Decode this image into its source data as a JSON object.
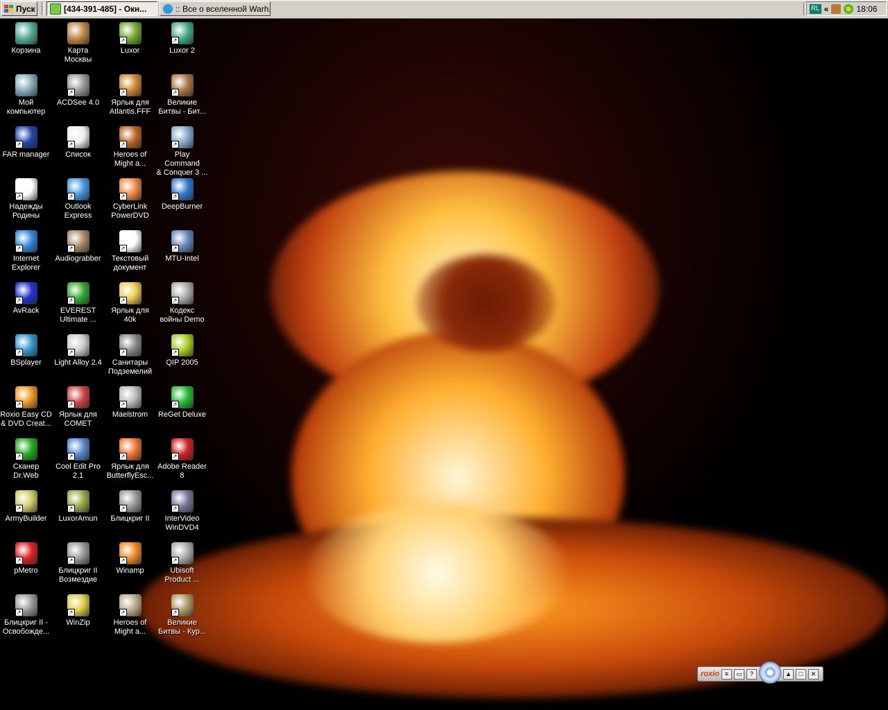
{
  "taskbar": {
    "start_label": "Пуск",
    "tasks": [
      {
        "label": "[434-391-485] - Окн...",
        "active": true
      },
      {
        "label": ":: Все о вселенной Warh...",
        "active": false
      }
    ],
    "tray": {
      "lang": "RL",
      "chevron": "«",
      "clock": "18:06"
    }
  },
  "roxio": {
    "logo": "roxio"
  },
  "icons": [
    {
      "label": "Корзина",
      "icon": "recycle-bin-icon",
      "color": "#5a9"
    },
    {
      "label": "Карта\nМосквы",
      "icon": "map-icon",
      "color": "#b84"
    },
    {
      "label": "Luxor",
      "icon": "scarab-icon",
      "color": "#7a3"
    },
    {
      "label": "Luxor 2",
      "icon": "scarab-icon",
      "color": "#4a8"
    },
    {
      "label": "Мой\nкомпьютер",
      "icon": "computer-icon",
      "color": "#8ab"
    },
    {
      "label": "ACDSee 4.0",
      "icon": "eye-icon",
      "color": "#999"
    },
    {
      "label": "Ярлык для\nAtlantis.FFF",
      "icon": "shell-icon",
      "color": "#c83"
    },
    {
      "label": "Великие\nБитвы - Бит...",
      "icon": "medal-icon",
      "color": "#a74"
    },
    {
      "label": "FAR manager",
      "icon": "far-icon",
      "color": "#24a"
    },
    {
      "label": "Список",
      "icon": "word-doc-icon",
      "color": "#eee"
    },
    {
      "label": "Heroes of\nMight a...",
      "icon": "heroes-icon",
      "color": "#b62"
    },
    {
      "label": "Play Command\n& Conquer 3 ...",
      "icon": "cnc-icon",
      "color": "#8ac"
    },
    {
      "label": "Надежды\nРодины",
      "icon": "text-doc-icon",
      "color": "#fff"
    },
    {
      "label": "Outlook\nExpress",
      "icon": "outlook-icon",
      "color": "#49d"
    },
    {
      "label": "CyberLink\nPowerDVD",
      "icon": "dvd-icon",
      "color": "#e84"
    },
    {
      "label": "DeepBurner",
      "icon": "deepburner-icon",
      "color": "#37c"
    },
    {
      "label": "Internet\nExplorer",
      "icon": "ie-icon",
      "color": "#38d"
    },
    {
      "label": "Audiograbber",
      "icon": "paw-icon",
      "color": "#a86"
    },
    {
      "label": "Текстовый\nдокумент",
      "icon": "text-doc-icon",
      "color": "#fff"
    },
    {
      "label": "MTU-Intel",
      "icon": "network-icon",
      "color": "#68b"
    },
    {
      "label": "AvRack",
      "icon": "avrack-icon",
      "color": "#23c"
    },
    {
      "label": "EVEREST\nUltimate ...",
      "icon": "info-icon",
      "color": "#3a3"
    },
    {
      "label": "Ярлык для\n40k",
      "icon": "folder-icon",
      "color": "#ec5"
    },
    {
      "label": "Кодекс\nвойны Demo",
      "icon": "aquila-icon",
      "color": "#aaa"
    },
    {
      "label": "BSplayer",
      "icon": "bsplayer-icon",
      "color": "#39c"
    },
    {
      "label": "Light Alloy 2.4",
      "icon": "light-alloy-icon",
      "color": "#ccc"
    },
    {
      "label": "Санитары\nПодземелий",
      "icon": "eagle-icon",
      "color": "#888"
    },
    {
      "label": "QIP 2005",
      "icon": "qip-icon",
      "color": "#ac2"
    },
    {
      "label": "Roxio Easy CD\n& DVD Creat...",
      "icon": "roxio-icon",
      "color": "#e92"
    },
    {
      "label": "Ярлык для\nCOMET",
      "icon": "comet-icon",
      "color": "#c44"
    },
    {
      "label": "Maelstrom",
      "icon": "maelstrom-icon",
      "color": "#bbb"
    },
    {
      "label": "ReGet Deluxe",
      "icon": "reget-icon",
      "color": "#2b3"
    },
    {
      "label": "Сканер\nDr.Web",
      "icon": "drweb-icon",
      "color": "#2a2"
    },
    {
      "label": "Cool Edit Pro\n2.1",
      "icon": "cooledit-icon",
      "color": "#58c"
    },
    {
      "label": "Ярлык для\nButterflyEsc...",
      "icon": "butterfly-icon",
      "color": "#e73"
    },
    {
      "label": "Adobe Reader\n8",
      "icon": "acrobat-icon",
      "color": "#c22"
    },
    {
      "label": "ArmyBuilder",
      "icon": "armybuilder-icon",
      "color": "#cc6"
    },
    {
      "label": "LuxorAmun",
      "icon": "scarab-icon",
      "color": "#9a4"
    },
    {
      "label": "Блицкриг II",
      "icon": "blitzkrieg-icon",
      "color": "#999"
    },
    {
      "label": "InterVideo\nWinDVD4",
      "icon": "windvd-icon",
      "color": "#779"
    },
    {
      "label": "pMetro",
      "icon": "metro-icon",
      "color": "#d22"
    },
    {
      "label": "Блицкриг II\nВозмездие",
      "icon": "blitzkrieg-icon",
      "color": "#999"
    },
    {
      "label": "Winamp",
      "icon": "winamp-icon",
      "color": "#e82"
    },
    {
      "label": "Ubisoft\nProduct ...",
      "icon": "ubisoft-icon",
      "color": "#aaa"
    },
    {
      "label": "Блицкриг II -\nОсвобожде...",
      "icon": "blitzkrieg-icon",
      "color": "#999"
    },
    {
      "label": "WinZip",
      "icon": "winzip-icon",
      "color": "#dc4"
    },
    {
      "label": "Heroes of\nMight a...",
      "icon": "heroes-icon",
      "color": "#ba8"
    },
    {
      "label": "Великие\nБитвы - Кур...",
      "icon": "medal-icon",
      "color": "#a96"
    }
  ]
}
